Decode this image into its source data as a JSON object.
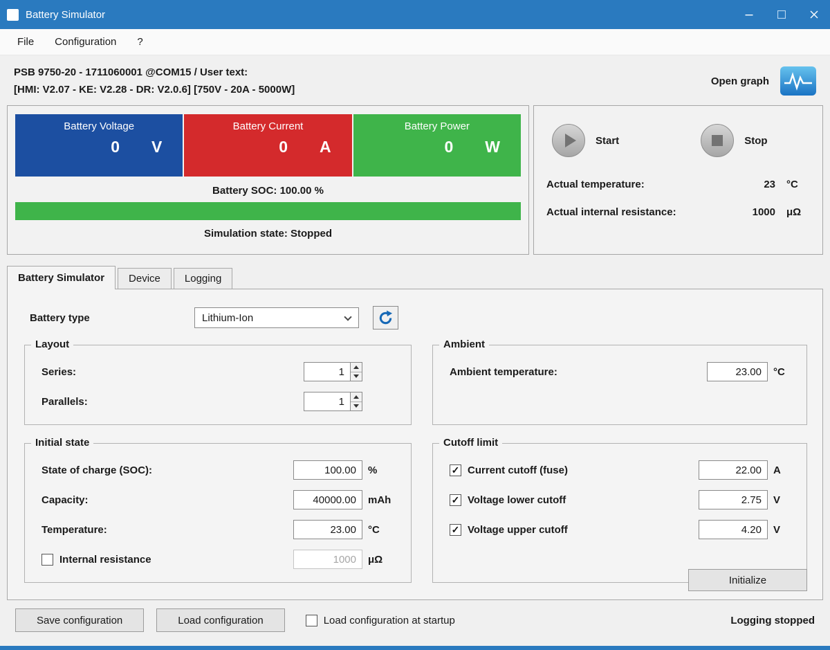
{
  "colors": {
    "titlebar": "#2a7abf",
    "voltage_box": "#1c4fa1",
    "current_box": "#d42a2c",
    "power_box": "#3fb44a",
    "progress_fill": "#3fb44a"
  },
  "window": {
    "title": "Battery Simulator"
  },
  "menu": {
    "items": [
      {
        "label": "File"
      },
      {
        "label": "Configuration"
      },
      {
        "label": "?"
      }
    ]
  },
  "device_info": {
    "line1": "PSB 9750-20 - 1711060001 @COM15 / User text:",
    "line2": "[HMI: V2.07 - KE: V2.28 - DR: V2.0.6] [750V - 20A - 5000W]",
    "open_graph": "Open graph"
  },
  "meters": [
    {
      "label": "Battery Voltage",
      "value": "0",
      "unit": "V"
    },
    {
      "label": "Battery Current",
      "value": "0",
      "unit": "A"
    },
    {
      "label": "Battery Power",
      "value": "0",
      "unit": "W"
    }
  ],
  "soc": {
    "label": "Battery SOC: 100.00 %",
    "fill_style": "width:100%"
  },
  "sim_state": "Simulation state: Stopped",
  "controls": {
    "start": "Start",
    "stop": "Stop",
    "readouts": [
      {
        "label": "Actual temperature:",
        "value": "23",
        "unit": "°C"
      },
      {
        "label": "Actual internal resistance:",
        "value": "1000",
        "unit": "μΩ"
      }
    ]
  },
  "tabs": [
    {
      "label": "Battery Simulator"
    },
    {
      "label": "Device"
    },
    {
      "label": "Logging"
    }
  ],
  "simulator_tab": {
    "battery_type_label": "Battery type",
    "battery_type_value": "Lithium-Ion",
    "layout": {
      "title": "Layout",
      "rows": [
        {
          "label": "Series:",
          "value": "1"
        },
        {
          "label": "Parallels:",
          "value": "1"
        }
      ]
    },
    "ambient": {
      "title": "Ambient",
      "label": "Ambient temperature:",
      "value": "23.00",
      "unit": "°C"
    },
    "initial": {
      "title": "Initial state",
      "rows": [
        {
          "label": "State of charge (SOC):",
          "value": "100.00",
          "unit": "%"
        },
        {
          "label": "Capacity:",
          "value": "40000.00",
          "unit": "mAh"
        },
        {
          "label": "Temperature:",
          "value": "23.00",
          "unit": "°C"
        }
      ],
      "resistance_row": {
        "label": "Internal resistance",
        "checked": false,
        "value": "1000",
        "unit": "μΩ"
      }
    },
    "cutoff": {
      "title": "Cutoff limit",
      "rows": [
        {
          "label": "Current cutoff (fuse)",
          "checked": true,
          "value": "22.00",
          "unit": "A"
        },
        {
          "label": "Voltage lower cutoff",
          "checked": true,
          "value": "2.75",
          "unit": "V"
        },
        {
          "label": "Voltage upper cutoff",
          "checked": true,
          "value": "4.20",
          "unit": "V"
        }
      ]
    },
    "initialize_label": "Initialize"
  },
  "footer": {
    "save": "Save configuration",
    "load": "Load configuration",
    "startup_label": "Load configuration at startup",
    "startup_checked": false,
    "status": "Logging stopped"
  }
}
